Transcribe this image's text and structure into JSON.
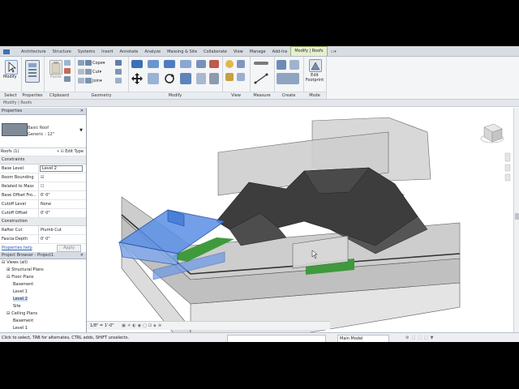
{
  "ribbon_tabs": [
    "Architecture",
    "Structure",
    "Systems",
    "Insert",
    "Annotate",
    "Analyze",
    "Massing & Site",
    "Collaborate",
    "View",
    "Manage",
    "Add-Ins",
    "Modify | Roofs"
  ],
  "panels": {
    "select": {
      "title": "Select",
      "modify_label": "Modify"
    },
    "properties": {
      "title": "Properties"
    },
    "clipboard": {
      "title": "Clipboard",
      "paste_label": "Paste"
    },
    "geometry": {
      "title": "Geometry",
      "cope_label": "Cope",
      "cut_label": "Cut",
      "join_label": "Join"
    },
    "modify": {
      "title": "Modify"
    },
    "view": {
      "title": "View"
    },
    "measure": {
      "title": "Measure"
    },
    "create": {
      "title": "Create"
    },
    "mode": {
      "title": "Mode",
      "edit_footprint_label": "Edit Footprint"
    }
  },
  "context_label": "Modify | Roofs",
  "properties_panel": {
    "header": "Properties",
    "type_family": "Basic Roof",
    "type_name": "Generic - 12\"",
    "instance_filter": "Roofs (1)",
    "edit_type_label": "Edit Type",
    "sections": [
      {
        "title": "Constraints",
        "rows": [
          {
            "name": "Base Level",
            "value": "Level 2",
            "box": true
          },
          {
            "name": "Room Bounding",
            "value": "☑",
            "box": false
          },
          {
            "name": "Related to Mass",
            "value": "☐",
            "box": false
          },
          {
            "name": "Base Offset Fro...",
            "value": "0' 0\"",
            "box": false
          },
          {
            "name": "Cutoff Level",
            "value": "None",
            "box": false
          },
          {
            "name": "Cutoff Offset",
            "value": "0' 0\"",
            "box": false
          }
        ]
      },
      {
        "title": "Construction",
        "rows": [
          {
            "name": "Rafter Cut",
            "value": "Plumb Cut",
            "box": false
          },
          {
            "name": "Fascia Depth",
            "value": "0' 0\"",
            "box": false
          }
        ]
      }
    ],
    "help_label": "Properties help",
    "apply_label": "Apply"
  },
  "project_browser": {
    "header": "Project Browser - Project1",
    "items": [
      {
        "label": "Views (all)",
        "indent": 0,
        "prefix": "⊟"
      },
      {
        "label": "Structural Plans",
        "indent": 1,
        "prefix": "⊞"
      },
      {
        "label": "Floor Plans",
        "indent": 1,
        "prefix": "⊟"
      },
      {
        "label": "Basement",
        "indent": 2,
        "prefix": ""
      },
      {
        "label": "Level 1",
        "indent": 2,
        "prefix": ""
      },
      {
        "label": "Level 2",
        "indent": 2,
        "prefix": "",
        "selected": true
      },
      {
        "label": "Site",
        "indent": 2,
        "prefix": ""
      },
      {
        "label": "Ceiling Plans",
        "indent": 1,
        "prefix": "⊟"
      },
      {
        "label": "Basement",
        "indent": 2,
        "prefix": ""
      },
      {
        "label": "Level 1",
        "indent": 2,
        "prefix": ""
      }
    ]
  },
  "view_control": {
    "scale": "1/8\" = 1'-0\""
  },
  "status": {
    "message": "Click to select, TAB for alternates, CTRL adds, SHIFT unselects.",
    "model": "Main Model"
  },
  "colors": {
    "selected_roof": "#5b8fe6",
    "roof_dark": "#3d3d3d",
    "glass": "#c9c9c9",
    "floor_green": "#3f9a3c",
    "accent_tab": "#9fb26a"
  }
}
